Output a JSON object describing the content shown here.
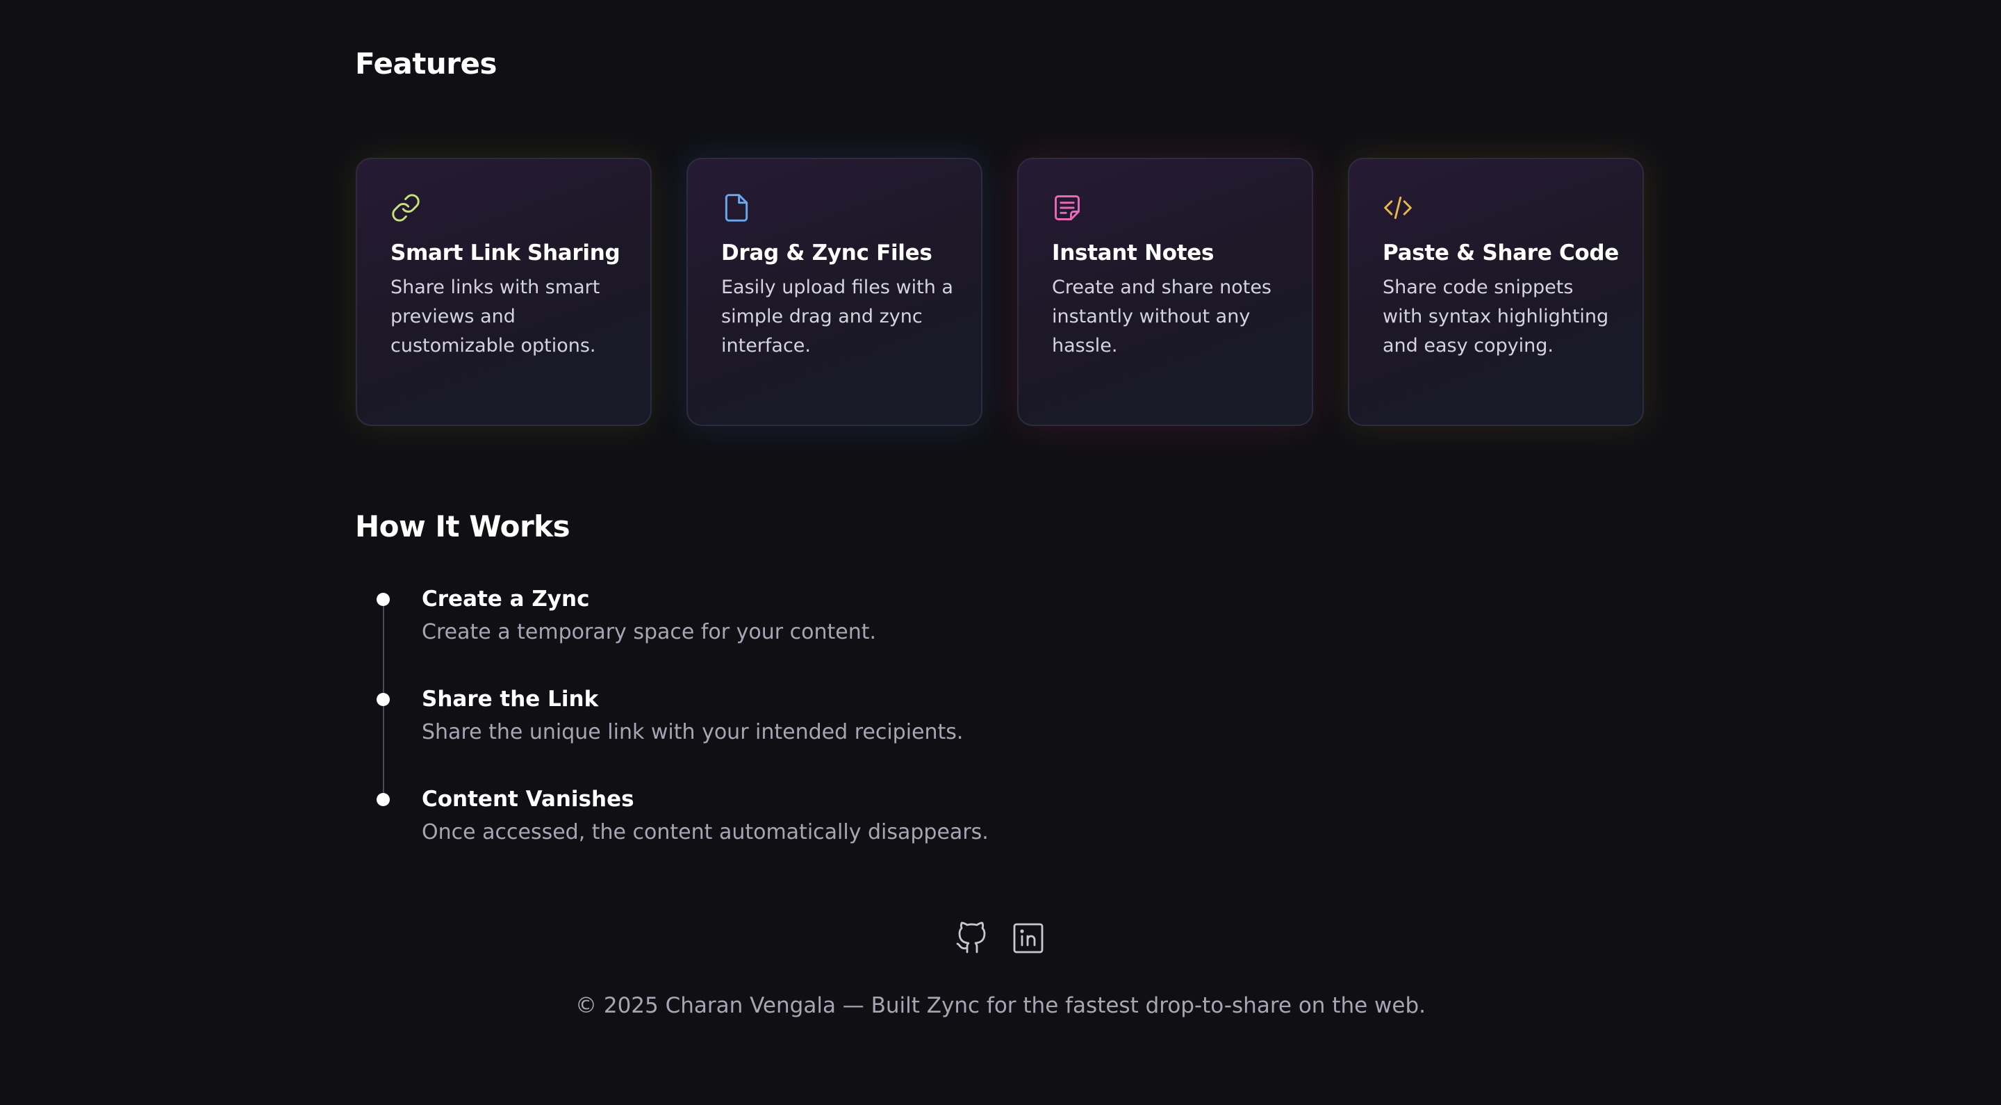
{
  "features": {
    "title": "Features",
    "cards": [
      {
        "icon": "link-icon",
        "icon_color": "#c6e27a",
        "title": "Smart Link Sharing",
        "description": "Share links with smart previews and customizable options."
      },
      {
        "icon": "file-icon",
        "icon_color": "#6aa8f0",
        "title": "Drag & Zync Files",
        "description": "Easily upload files with a simple drag and zync interface."
      },
      {
        "icon": "note-icon",
        "icon_color": "#e56bb8",
        "title": "Instant Notes",
        "description": "Create and share notes instantly without any hassle."
      },
      {
        "icon": "code-icon",
        "icon_color": "#e8b84a",
        "title": "Paste & Share Code",
        "description": "Share code snippets with syntax highlighting and easy copying."
      }
    ]
  },
  "how_it_works": {
    "title": "How It Works",
    "steps": [
      {
        "title": "Create a Zync",
        "description": "Create a temporary space for your content."
      },
      {
        "title": "Share the Link",
        "description": "Share the unique link with your intended recipients."
      },
      {
        "title": "Content Vanishes",
        "description": "Once accessed, the content automatically disappears."
      }
    ]
  },
  "footer": {
    "social_icons": [
      "github-icon",
      "linkedin-icon"
    ],
    "copyright": "© 2025 Charan Vengala — Built Zync for the fastest drop-to-share on the web."
  }
}
